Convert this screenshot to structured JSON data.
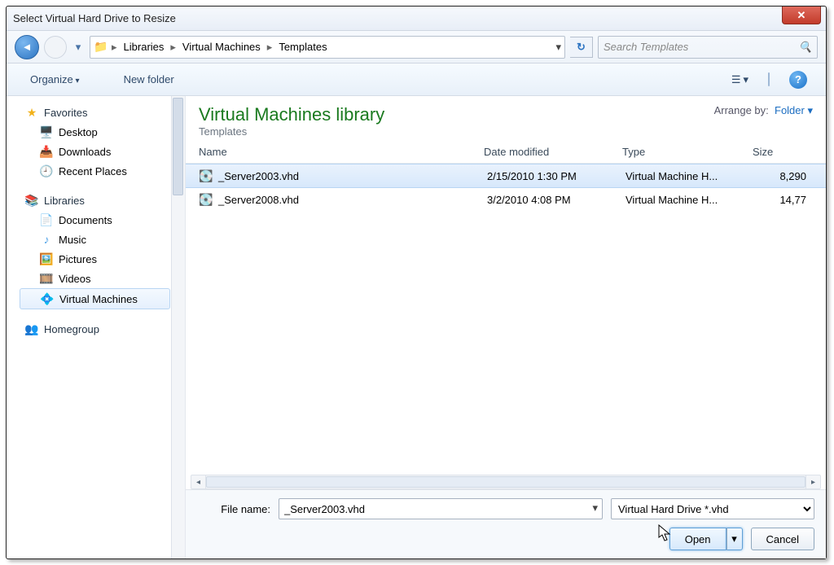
{
  "window": {
    "title": "Select Virtual Hard Drive to Resize"
  },
  "breadcrumb": [
    "Libraries",
    "Virtual Machines",
    "Templates"
  ],
  "search": {
    "placeholder": "Search Templates"
  },
  "toolbar": {
    "organize": "Organize",
    "newfolder": "New folder"
  },
  "sidebar": {
    "favorites": {
      "label": "Favorites",
      "items": [
        "Desktop",
        "Downloads",
        "Recent Places"
      ]
    },
    "libraries": {
      "label": "Libraries",
      "items": [
        "Documents",
        "Music",
        "Pictures",
        "Videos",
        "Virtual Machines"
      ],
      "selected": 4
    },
    "homegroup": {
      "label": "Homegroup"
    }
  },
  "library": {
    "title": "Virtual Machines library",
    "subtitle": "Templates",
    "arrange_label": "Arrange by:",
    "arrange_value": "Folder"
  },
  "columns": [
    "Name",
    "Date modified",
    "Type",
    "Size"
  ],
  "files": [
    {
      "name": "_Server2003.vhd",
      "date": "2/15/2010 1:30 PM",
      "type": "Virtual Machine H...",
      "size": "8,290",
      "selected": true
    },
    {
      "name": "_Server2008.vhd",
      "date": "3/2/2010 4:08 PM",
      "type": "Virtual Machine H...",
      "size": "14,77",
      "selected": false
    }
  ],
  "footer": {
    "file_label": "File name:",
    "file_value": "_Server2003.vhd",
    "filter": "Virtual Hard Drive *.vhd",
    "open": "Open",
    "cancel": "Cancel"
  }
}
